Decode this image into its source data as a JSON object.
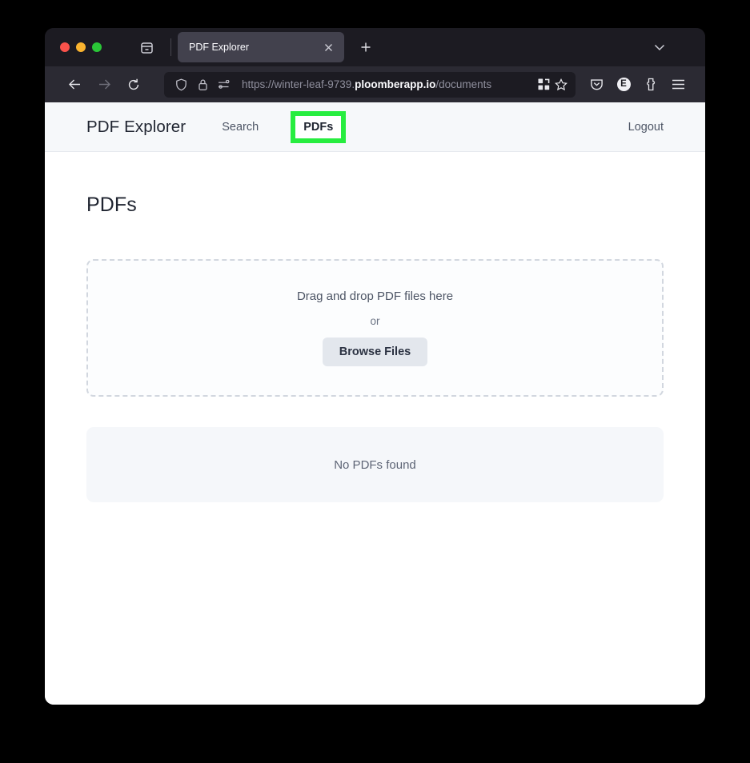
{
  "browser": {
    "window_controls": [
      "close",
      "minimize",
      "maximize"
    ],
    "tab_list_icon": "tab-list-icon",
    "tabs": [
      {
        "title": "PDF Explorer",
        "close_icon": "close-icon",
        "active": true
      }
    ],
    "new_tab_icon": "plus-icon",
    "tabstrip_chevron_icon": "chevron-down-icon",
    "toolbar": {
      "back_icon": "back-arrow-icon",
      "forward_icon": "forward-arrow-icon",
      "reload_icon": "reload-icon",
      "shield_icon": "shield-icon",
      "lock_icon": "lock-icon",
      "permissions_icon": "permissions-icon",
      "url_prefix": "https://winter-leaf-9739.",
      "url_host": "ploomberapp.io",
      "url_path": "/documents",
      "url_full": "https://winter-leaf-9739.ploomberapp.io/documents",
      "qr_icon": "qr-code-icon",
      "bookmark_icon": "star-icon",
      "pocket_icon": "pocket-icon",
      "account_label": "E",
      "extensions_icon": "extensions-icon",
      "menu_icon": "hamburger-menu-icon"
    }
  },
  "app": {
    "brand": "PDF Explorer",
    "nav_items": [
      {
        "label": "Search",
        "active": false
      },
      {
        "label": "PDFs",
        "active": true
      }
    ],
    "logout_label": "Logout",
    "highlight_color": "#27ed3f",
    "page_title": "PDFs",
    "dropzone": {
      "primary_text": "Drag and drop PDF files here",
      "or_text": "or",
      "browse_label": "Browse Files"
    },
    "empty_state": {
      "message": "No PDFs found"
    }
  }
}
